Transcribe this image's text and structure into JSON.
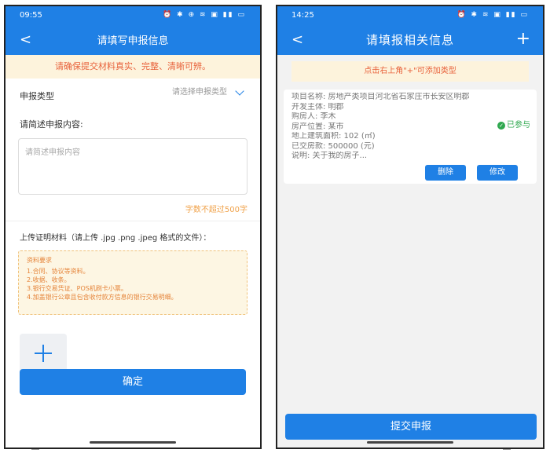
{
  "left": {
    "status": {
      "time": "09:55",
      "icons": "⏰ ✱ ⊕ ≋ ▣ ▮▮ ▭"
    },
    "nav": {
      "back": "<",
      "title": "请填写申报信息"
    },
    "notice": "请确保提交材料真实、完整、清晰可辨。",
    "declare_type": {
      "label": "申报类型",
      "placeholder": "请选择申报类型"
    },
    "describe": {
      "label": "请简述申报内容:",
      "placeholder": "请简述申报内容",
      "counter": "字数不超过500字"
    },
    "upload_label": "上传证明材料（请上传 .jpg .png .jpeg 格式的文件）：",
    "requirements": {
      "title": "资料要求",
      "items": [
        "1.合同、协议等资料。",
        "2.收据、收条。",
        "3.银行交易凭证、POS机刷卡小票。",
        "4.加盖银行公章且包含收付款方信息的银行交易明细。"
      ]
    },
    "confirm_button": "确定"
  },
  "right": {
    "status": {
      "time": "14:25",
      "icons": "⏰ ✱ ≋ ▣ ▮▮ ▭"
    },
    "nav": {
      "back": "<",
      "title": "请填报相关信息",
      "add": "+"
    },
    "hint": "点击右上角\"+\"可添加类型",
    "card": {
      "lines": [
        "项目名称: 房地产类项目河北省石家庄市长安区明郡",
        "开发主体: 明郡",
        "购房人: 李木",
        "房产位置: 某市",
        "地上建筑面积: 102 (㎡)",
        "已交房款: 500000 (元)",
        "说明:  关于我的房子..."
      ],
      "badge": "已参与",
      "delete_button": "删除",
      "edit_button": "修改"
    },
    "submit_button": "提交申报"
  }
}
